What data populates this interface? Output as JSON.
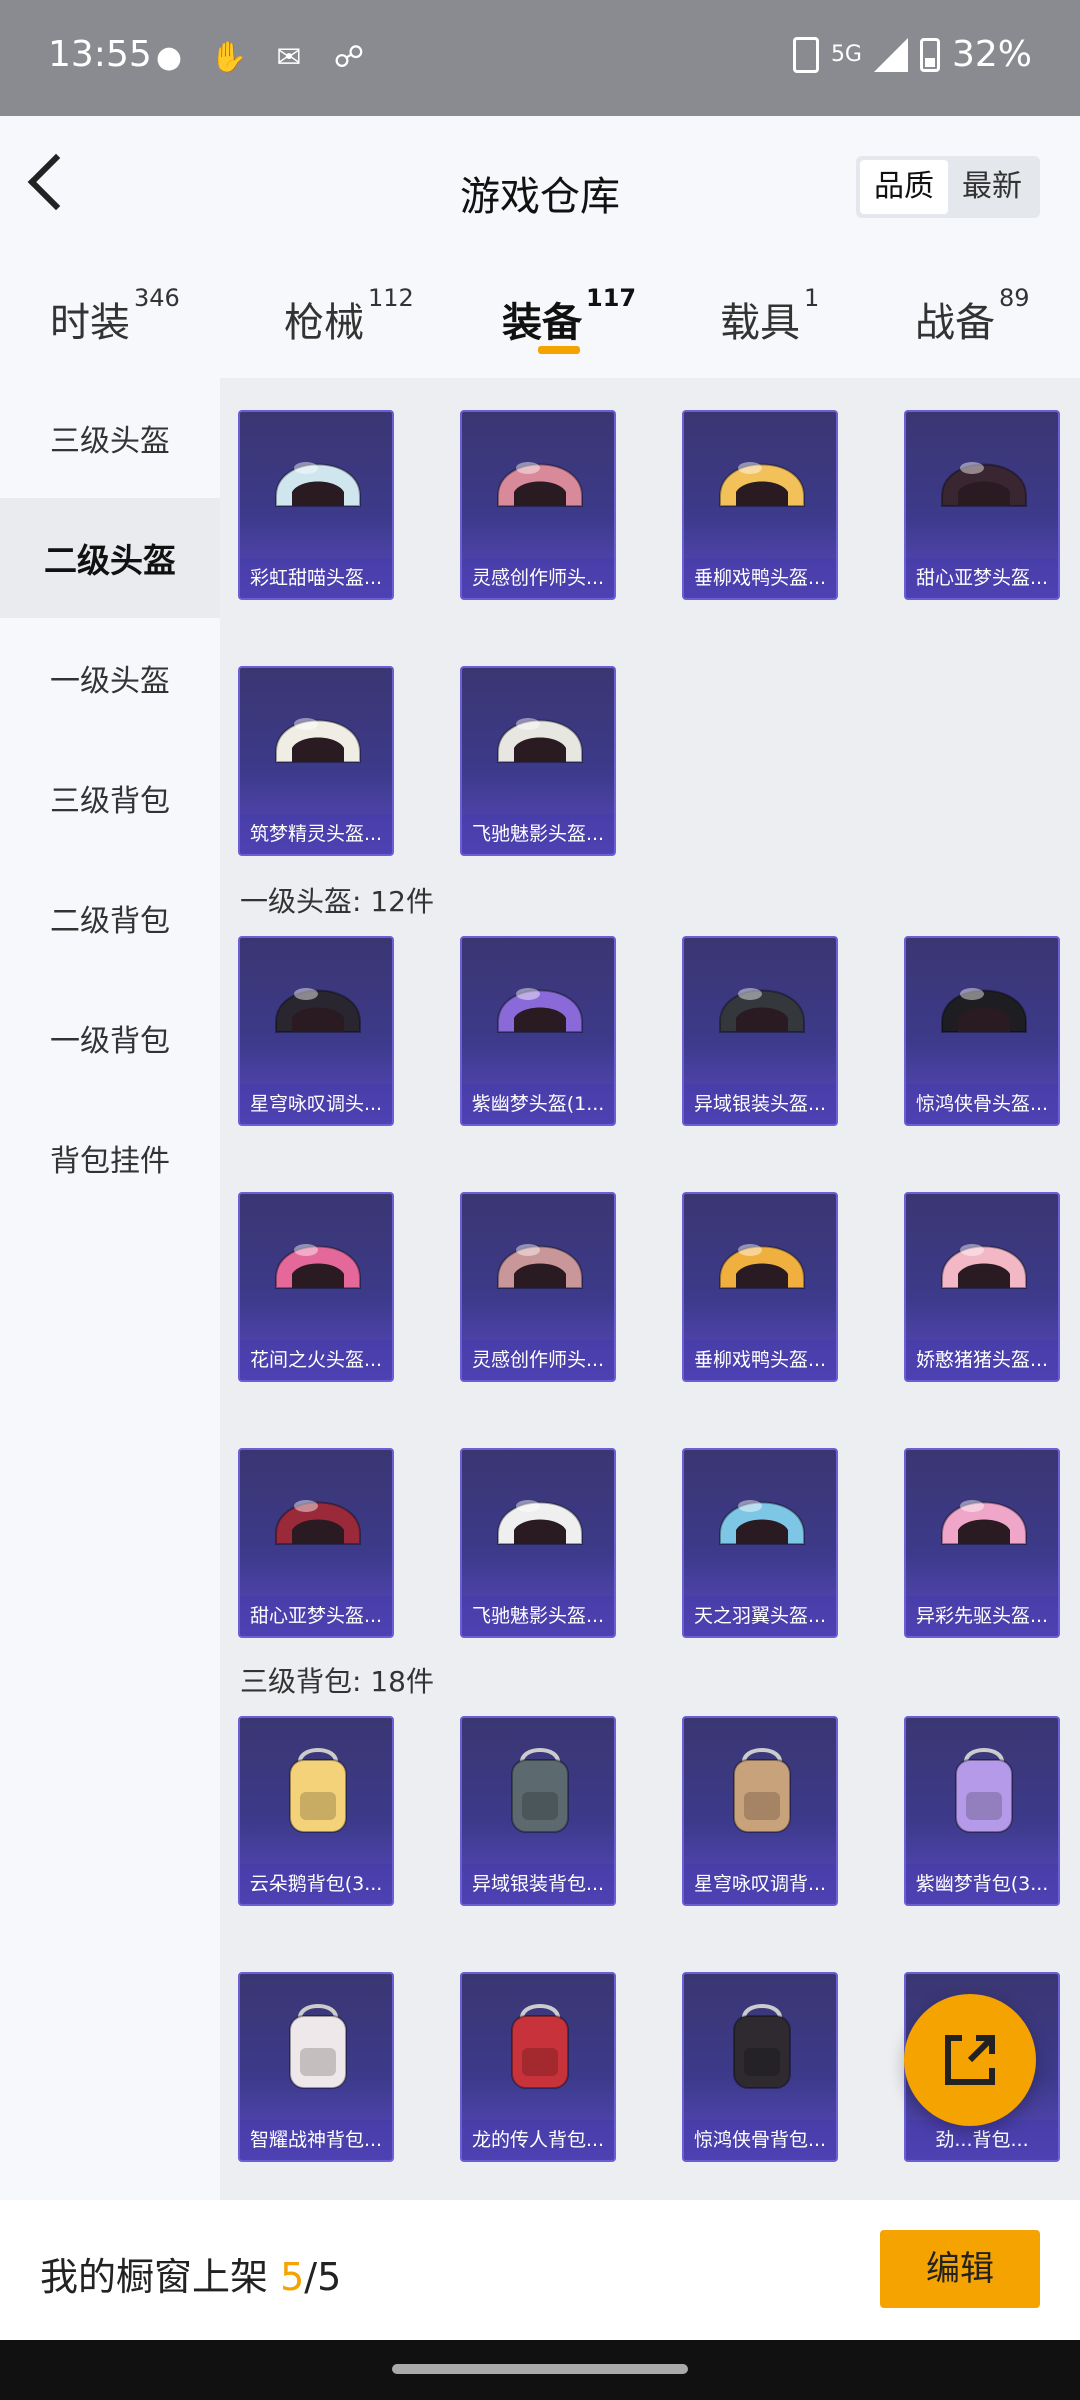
{
  "status": {
    "time": "13:55",
    "network": "5G",
    "battery": "32%"
  },
  "header": {
    "title": "游戏仓库",
    "sort_options": [
      "品质",
      "最新"
    ]
  },
  "tabs": [
    {
      "label": "时装",
      "count": "346"
    },
    {
      "label": "枪械",
      "count": "112"
    },
    {
      "label": "装备",
      "count": "117"
    },
    {
      "label": "载具",
      "count": "1"
    },
    {
      "label": "战备",
      "count": "89"
    }
  ],
  "sidebar": [
    "三级头盔",
    "二级头盔",
    "一级头盔",
    "三级背包",
    "二级背包",
    "一级背包",
    "背包挂件"
  ],
  "sections": {
    "level2_helmet": {
      "items": [
        {
          "name": "彩虹甜喵头盔...",
          "color": "#cfe6ef"
        },
        {
          "name": "灵感创作师头...",
          "color": "#d8899a"
        },
        {
          "name": "垂柳戏鸭头盔...",
          "color": "#f2c15a"
        },
        {
          "name": "甜心亚梦头盔...",
          "color": "#3a2630"
        },
        {
          "name": "筑梦精灵头盔...",
          "color": "#f0eee4"
        },
        {
          "name": "飞驰魅影头盔...",
          "color": "#e8e6e0"
        }
      ]
    },
    "level1_helmet": {
      "title": "一级头盔: 12件",
      "items": [
        {
          "name": "星穹咏叹调头...",
          "color": "#2a2630"
        },
        {
          "name": "紫幽梦头盔(1...",
          "color": "#8a6ad8"
        },
        {
          "name": "异域银装头盔...",
          "color": "#34383c"
        },
        {
          "name": "惊鸿侠骨头盔...",
          "color": "#1e1e22"
        },
        {
          "name": "花间之火头盔...",
          "color": "#e4689a"
        },
        {
          "name": "灵感创作师头...",
          "color": "#c9969a"
        },
        {
          "name": "垂柳戏鸭头盔...",
          "color": "#f0b040"
        },
        {
          "name": "娇憨猪猪头盔...",
          "color": "#f2b8c6"
        },
        {
          "name": "甜心亚梦头盔...",
          "color": "#9a2a3a"
        },
        {
          "name": "飞驰魅影头盔...",
          "color": "#efefef"
        },
        {
          "name": "天之羽翼头盔...",
          "color": "#7ec6e6"
        },
        {
          "name": "异彩先驱头盔...",
          "color": "#f0a6c8"
        }
      ]
    },
    "level3_backpack": {
      "title": "三级背包: 18件",
      "items": [
        {
          "name": "云朵鹅背包(3...",
          "color": "#f4d27a"
        },
        {
          "name": "异域银装背包...",
          "color": "#5c6a70"
        },
        {
          "name": "星穹咏叹调背...",
          "color": "#c8a27a"
        },
        {
          "name": "紫幽梦背包(3...",
          "color": "#b49ae8"
        },
        {
          "name": "智耀战神背包...",
          "color": "#efe8ea"
        },
        {
          "name": "龙的传人背包...",
          "color": "#c8323a"
        },
        {
          "name": "惊鸿侠骨背包...",
          "color": "#2e2a30"
        },
        {
          "name": "劲...背包...",
          "color": "#e0c4c8"
        }
      ]
    }
  },
  "bottom": {
    "label": "我的橱窗上架 ",
    "count": "5",
    "total": "/5",
    "edit": "编辑"
  }
}
